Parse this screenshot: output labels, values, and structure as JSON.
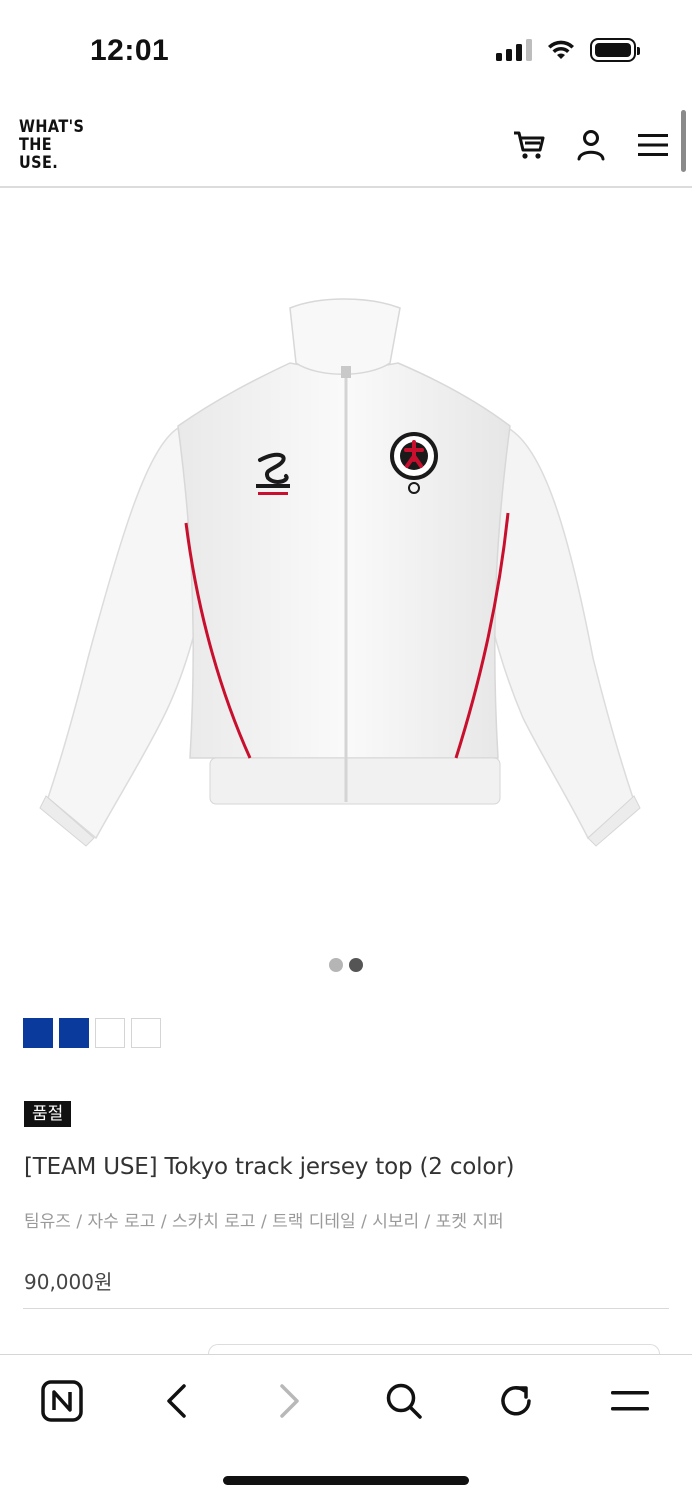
{
  "status_bar": {
    "time": "12:01"
  },
  "header": {
    "logo": "WHAT'S\nTHE\nUSE.",
    "icons": [
      "cart-icon",
      "user-icon",
      "menu-icon"
    ]
  },
  "product": {
    "image_description_icon": "white-track-jacket-image",
    "image_dots": {
      "total": 2,
      "active": 2
    },
    "swatches": [
      {
        "color": "#0a3a9c"
      },
      {
        "color": "#0a3a9c"
      },
      {
        "color": "#ffffff"
      },
      {
        "color": "#ffffff"
      }
    ],
    "badge": "품절",
    "title": "[TEAM USE] Tokyo track jersey top (2 color)",
    "subtitle": "팀유즈 / 자수 로고 / 스카치 로고 / 트랙 디테일 / 시보리 / 포켓 지퍼",
    "price": "90,000원"
  },
  "colors": {
    "accent_red": "#c8102e",
    "navy": "#0a3a9c"
  },
  "toolbar": {
    "items": [
      "naver-home-icon",
      "back-icon",
      "forward-icon",
      "search-icon",
      "refresh-icon",
      "menu-icon"
    ]
  }
}
